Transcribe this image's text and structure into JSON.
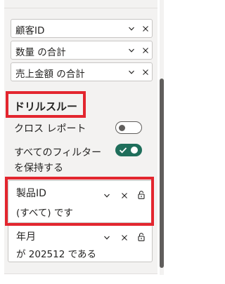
{
  "fields": [
    {
      "label": "顧客ID"
    },
    {
      "label": "数量 の合計"
    },
    {
      "label": "売上金額 の合計"
    }
  ],
  "drillthrough": {
    "title": "ドリルスルー",
    "cross_report": {
      "label": "クロス レポート",
      "state": "off"
    },
    "keep_all_filters": {
      "label_line1": "すべてのフィルター",
      "label_line2": "を保持する",
      "state": "on"
    }
  },
  "filters": [
    {
      "name": "製品ID",
      "value": "(すべて) です"
    },
    {
      "name": "年月",
      "value": "が 202512 である"
    }
  ],
  "colors": {
    "highlight": "#e3262f",
    "toggle_on": "#1f6e5b",
    "panel_bg": "#f3f2f1"
  },
  "icons": {
    "expand": "chevron-down-icon",
    "remove": "close-icon",
    "lock": "unlock-icon"
  }
}
